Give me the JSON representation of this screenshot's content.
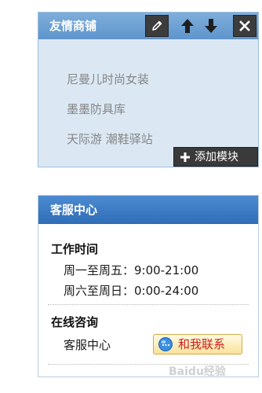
{
  "friend_shops": {
    "title": "友情商铺",
    "shops": [
      "尼曼儿时尚女装",
      "墨墨防具库",
      "天际游 潮鞋驿站"
    ],
    "add_module_label": "添加模块",
    "icons": [
      "edit-icon",
      "move-up-icon",
      "move-down-icon",
      "close-icon",
      "plus-icon"
    ]
  },
  "customer_service": {
    "title": "客服中心",
    "work_hours_title": "工作时间",
    "hours": [
      "周一至周五：9:00-21:00",
      "周六至周日：0:00-24:00"
    ],
    "online_title": "在线咨询",
    "contact_label": "客服中心",
    "contact_button_label": "和我联系",
    "contact_icon": "chat-bubble-icon"
  },
  "watermark": "Baidu经验",
  "colors": {
    "friend_header": "#6ea0d6",
    "friend_body": "#dbe8f4",
    "service_header": "#3b7cc6",
    "contact_button_text": "#cc1f1f"
  }
}
